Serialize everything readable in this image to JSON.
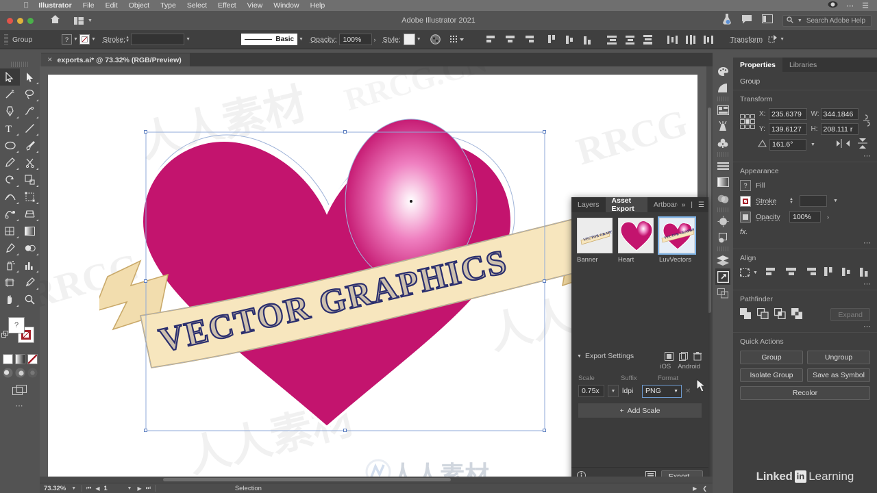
{
  "os_menu": {
    "apple_icon": "apple-icon",
    "app_name": "Illustrator",
    "items": [
      "File",
      "Edit",
      "Object",
      "Type",
      "Select",
      "Effect",
      "View",
      "Window",
      "Help"
    ],
    "right_icons": [
      "creative-cloud-icon",
      "more-icon",
      "list-icon"
    ]
  },
  "titlebar": {
    "title": "Adobe Illustrator 2021",
    "home_icon": "home-icon",
    "workspace_icon": "workspace-switcher-icon",
    "right_icons": [
      "discover-icon",
      "comments-icon",
      "arrange-documents-icon"
    ],
    "search": {
      "icon": "search-icon",
      "placeholder": "Search Adobe Help",
      "value": ""
    }
  },
  "control_bar": {
    "selection_label": "Group",
    "fill_swatch_label": "?",
    "stroke_label": "Stroke:",
    "stroke_weight": "",
    "stroke_profile": "Basic",
    "opacity_label": "Opacity:",
    "opacity_value": "100%",
    "style_label": "Style:",
    "transform_label": "Transform",
    "icons": [
      "recolor-artwork-icon",
      "align-options-icon",
      "align-left-icon",
      "align-center-h-icon",
      "align-right-icon",
      "align-top-icon",
      "align-middle-v-icon",
      "align-bottom-icon",
      "distribute-top-icon",
      "distribute-center-v-icon",
      "distribute-bottom-icon",
      "distribute-left-icon",
      "distribute-center-h-icon",
      "distribute-right-icon"
    ]
  },
  "document_tab": {
    "close_icon": "close-icon",
    "label": "exports.ai* @ 73.32% (RGB/Preview)"
  },
  "left_toolbar": {
    "tools": [
      {
        "name": "selection-tool",
        "active": true
      },
      {
        "name": "direct-selection-tool",
        "active": false
      },
      {
        "name": "magic-wand-tool",
        "active": false
      },
      {
        "name": "lasso-tool",
        "active": false
      },
      {
        "name": "pen-tool",
        "active": false
      },
      {
        "name": "curvature-tool",
        "active": false
      },
      {
        "name": "type-tool",
        "active": false
      },
      {
        "name": "line-segment-tool",
        "active": false
      },
      {
        "name": "ellipse-tool",
        "active": false
      },
      {
        "name": "paintbrush-tool",
        "active": false
      },
      {
        "name": "pencil-tool",
        "active": false
      },
      {
        "name": "scissors-tool",
        "active": false
      },
      {
        "name": "rotate-tool",
        "active": false
      },
      {
        "name": "scale-tool",
        "active": false
      },
      {
        "name": "width-tool",
        "active": false
      },
      {
        "name": "free-transform-tool",
        "active": false
      },
      {
        "name": "shape-builder-tool",
        "active": false
      },
      {
        "name": "perspective-grid-tool",
        "active": false
      },
      {
        "name": "mesh-tool",
        "active": false
      },
      {
        "name": "gradient-tool",
        "active": false
      },
      {
        "name": "eyedropper-tool",
        "active": false
      },
      {
        "name": "blend-tool",
        "active": false
      },
      {
        "name": "symbol-sprayer-tool",
        "active": false
      },
      {
        "name": "column-graph-tool",
        "active": false
      },
      {
        "name": "artboard-tool",
        "active": false
      },
      {
        "name": "slice-tool",
        "active": false
      },
      {
        "name": "hand-tool",
        "active": false
      },
      {
        "name": "zoom-tool",
        "active": false
      }
    ],
    "fill_label": "?",
    "modes": [
      "color-mode-icon",
      "gradient-mode-icon",
      "none-mode-icon"
    ],
    "draw_modes": [
      "draw-normal-icon",
      "draw-behind-icon",
      "draw-inside-icon"
    ],
    "screen_mode_icon": "change-screen-mode-icon",
    "more_tools_icon": "edit-toolbar-icon"
  },
  "canvas": {
    "artwork_title": "VECTOR GRAPHICS",
    "heart_color": "#C3146E",
    "highlight_color": "#FFFFFF",
    "banner_color": "#F6E3B8",
    "banner_stroke": "#C9A96A",
    "text_color": "#2A2E6E",
    "selection_color": "#8FA9D8",
    "watermarks": [
      "RRCG",
      "人人素材",
      "RRCG.CN"
    ]
  },
  "asset_export": {
    "tabs": [
      {
        "label": "Layers",
        "selected": false
      },
      {
        "label": "Asset Export",
        "selected": true
      },
      {
        "label": "Artboards",
        "selected": false
      }
    ],
    "collapse_icon": "collapse-panel-icon",
    "menu_icon": "panel-menu-icon",
    "assets": [
      {
        "label": "Banner",
        "selected": false,
        "kind": "banner-thumbnail"
      },
      {
        "label": "Heart",
        "selected": false,
        "kind": "heart-thumbnail"
      },
      {
        "label": "LuvVectors",
        "selected": true,
        "kind": "luvvectors-thumbnail"
      }
    ],
    "export_settings": {
      "title": "Export Settings",
      "disclosure_icon": "disclosure-triangle-down-icon",
      "toolbar_icons": [
        "generate-single-asset-icon",
        "generate-multiple-assets-icon",
        "delete-asset-icon"
      ],
      "platforms": [
        "iOS",
        "Android"
      ],
      "columns": [
        "Scale",
        "Suffix",
        "Format"
      ],
      "rows": [
        {
          "scale": "0.75x",
          "suffix": "ldpi",
          "format": "PNG",
          "remove_icon": "remove-scale-icon"
        }
      ],
      "add_scale_label": "Add Scale",
      "add_icon": "plus-icon"
    },
    "footer": {
      "info_icon": "info-icon",
      "launch_icon": "launch-export-dialog-icon",
      "export_label": "Export..."
    }
  },
  "dock_icons": [
    "color-panel-icon",
    "color-guide-panel-icon",
    "libraries-panel-icon",
    "brushes-panel-icon",
    "symbols-panel-icon",
    "align-panel-icon",
    "gradient-panel-icon",
    "transparency-panel-icon",
    "appearance-panel-icon",
    "graphic-styles-panel-icon",
    "layers-panel-icon",
    "asset-export-panel-icon",
    "artboards-panel-icon"
  ],
  "properties": {
    "tabs": [
      {
        "label": "Properties",
        "selected": true
      },
      {
        "label": "Libraries",
        "selected": false
      }
    ],
    "object_type": "Group",
    "transform": {
      "heading": "Transform",
      "reference_point_icon": "reference-point-icon",
      "x_label": "X:",
      "x_value": "235.6379",
      "y_label": "Y:",
      "y_value": "139.6127",
      "w_label": "W:",
      "w_value": "344.1846",
      "h_label": "H:",
      "h_value": "208.111 r",
      "link_icon": "unlink-proportions-icon",
      "angle_label": "angle-icon",
      "angle_value": "161.6°",
      "flip_h_icon": "flip-horizontal-icon",
      "flip_v_icon": "flip-vertical-icon",
      "more_icon": "more-options-icon"
    },
    "appearance": {
      "heading": "Appearance",
      "fill_label": "Fill",
      "fill_swatch": "?",
      "stroke_label": "Stroke",
      "stroke_weight": "",
      "opacity_label": "Opacity",
      "opacity_value": "100%",
      "fx_label": "fx.",
      "more_icon": "more-options-icon"
    },
    "align": {
      "heading": "Align",
      "icons": [
        "align-to-selection-icon",
        "align-left-icon",
        "align-center-h-icon",
        "align-right-icon",
        "align-top-icon",
        "align-middle-v-icon",
        "align-bottom-icon"
      ],
      "more_icon": "more-options-icon"
    },
    "pathfinder": {
      "heading": "Pathfinder",
      "icons": [
        "unite-icon",
        "minus-front-icon",
        "intersect-icon",
        "exclude-icon"
      ],
      "expand_label": "Expand",
      "more_icon": "more-options-icon"
    },
    "quick_actions": {
      "heading": "Quick Actions",
      "buttons": [
        "Group",
        "Ungroup",
        "Isolate Group",
        "Save as Symbol",
        "Recolor"
      ]
    },
    "branding": {
      "word1": "Linked",
      "badge": "in",
      "word2": "Learning"
    }
  },
  "status_bar": {
    "zoom_value": "73.32%",
    "zoom_dropdown_icon": "chevron-down-icon",
    "first_page_icon": "first-artboard-icon",
    "prev_page_icon": "prev-artboard-icon",
    "page_value": "1",
    "page_dropdown_icon": "chevron-down-icon",
    "next_page_icon": "next-artboard-icon",
    "last_page_icon": "last-artboard-icon",
    "status_text": "Selection",
    "play_icon": "play-icon",
    "back_icon": "back-icon"
  }
}
